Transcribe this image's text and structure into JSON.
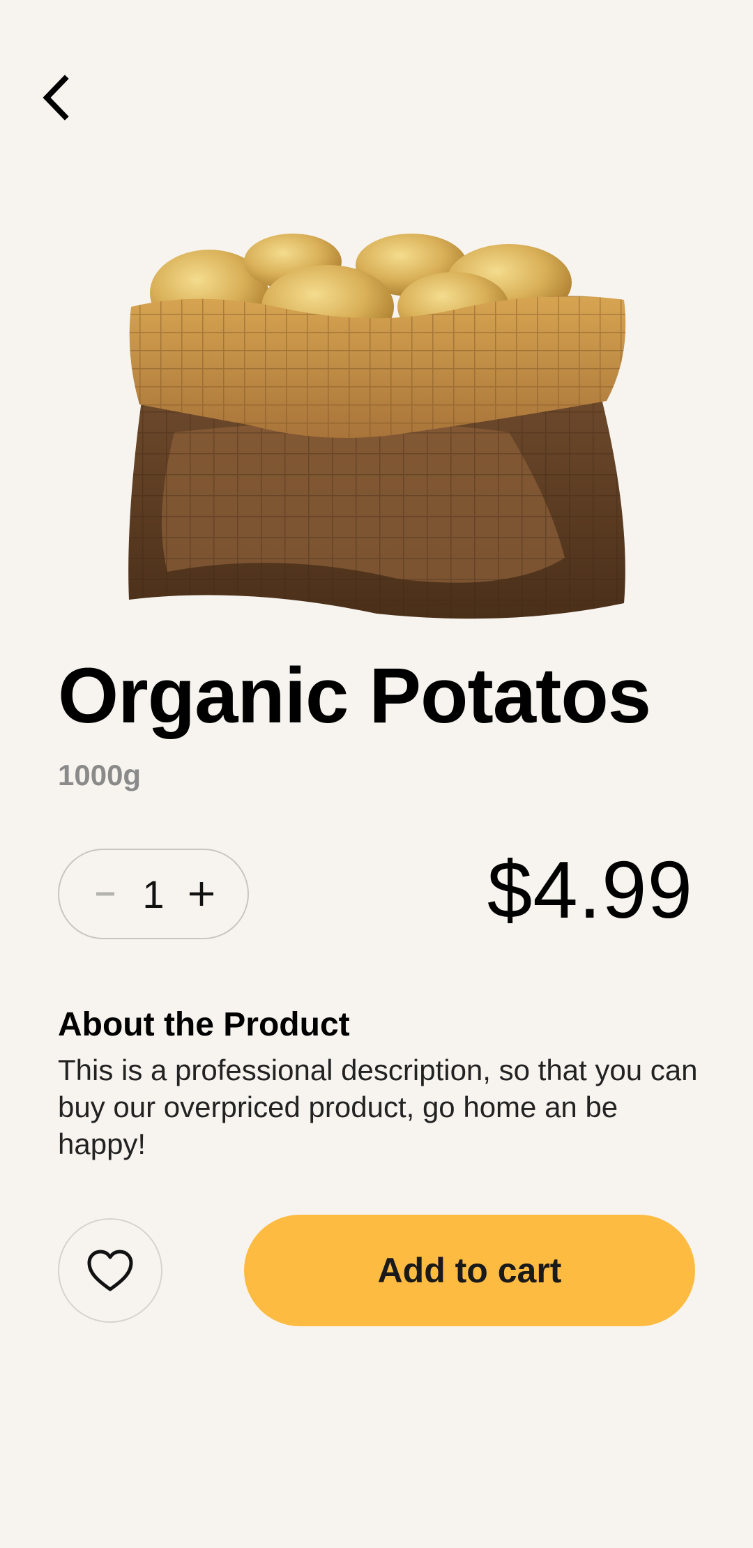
{
  "product": {
    "name": "Organic Potatos",
    "weight": "1000g",
    "quantity": "1",
    "price": "$4.99"
  },
  "icons": {
    "back": "chevron-left-icon",
    "decrement": "minus-icon",
    "increment": "plus-icon",
    "favorite": "heart-outline-icon"
  },
  "about": {
    "title": "About the Product",
    "description": "This is a professional description, so that you can buy our overpriced product, go home an be happy!"
  },
  "actions": {
    "add_to_cart": "Add to cart"
  },
  "colors": {
    "background": "#f7f4ef",
    "accent": "#fdbb42"
  }
}
